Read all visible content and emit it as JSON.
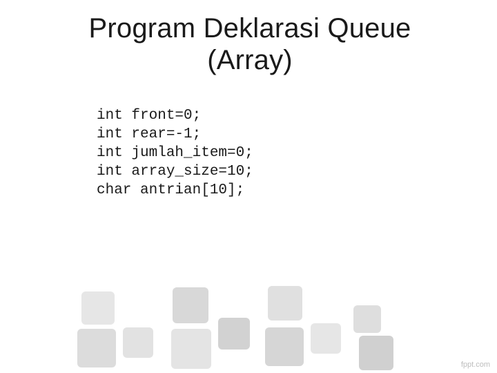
{
  "title": "Program Deklarasi Queue (Array)",
  "code": {
    "line1": "int front=0;",
    "line2": "int rear=-1;",
    "line3": "int jumlah_item=0;",
    "line4": "int array_size=10;",
    "line5": "char antrian[10];"
  },
  "watermark": "fppt.com",
  "colors": {
    "sq_light": "#e8e8e8",
    "sq_med": "#d6d6d6",
    "sq_dark": "#c9c9c9"
  }
}
